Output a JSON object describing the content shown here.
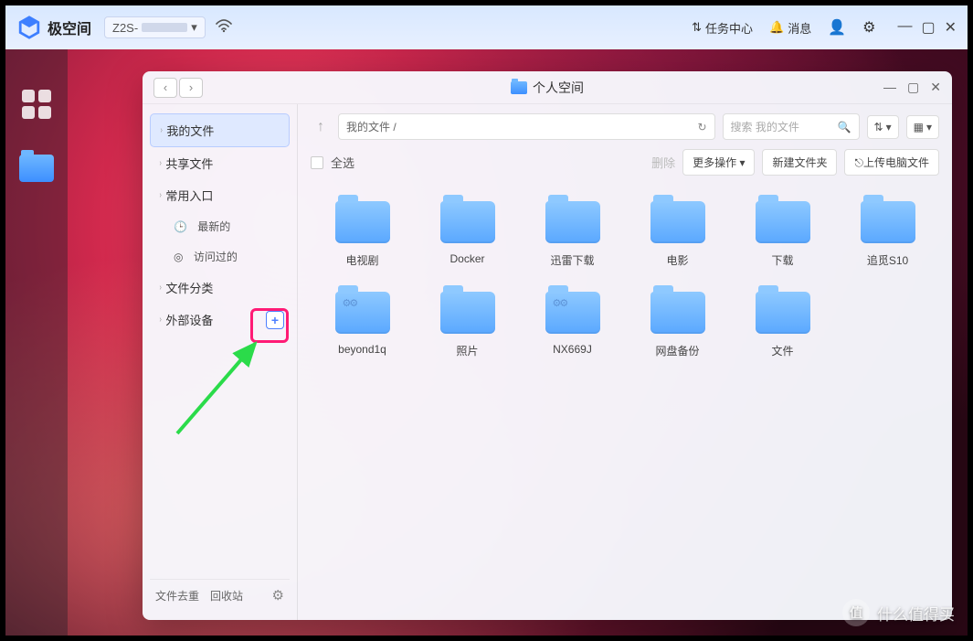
{
  "brand": "极空间",
  "device": "Z2S-",
  "topbar": {
    "tasks": "任务中心",
    "messages": "消息"
  },
  "window": {
    "title": "个人空间",
    "path": "我的文件 /",
    "search_placeholder": "搜索 我的文件"
  },
  "sidebar": {
    "items": [
      "我的文件",
      "共享文件",
      "常用入口",
      "文件分类",
      "外部设备"
    ],
    "sub_recent": "最新的",
    "sub_visited": "访问过的",
    "dedupe": "文件去重",
    "recycle": "回收站"
  },
  "actions": {
    "select_all": "全选",
    "delete": "删除",
    "more": "更多操作",
    "new_folder": "新建文件夹",
    "upload": "上传电脑文件"
  },
  "folders": [
    {
      "name": "电视剧",
      "cogs": false
    },
    {
      "name": "Docker",
      "cogs": false
    },
    {
      "name": "迅雷下载",
      "cogs": false
    },
    {
      "name": "电影",
      "cogs": false
    },
    {
      "name": "下载",
      "cogs": false
    },
    {
      "name": "追觅S10",
      "cogs": false
    },
    {
      "name": "beyond1q",
      "cogs": true
    },
    {
      "name": "照片",
      "cogs": false
    },
    {
      "name": "NX669J",
      "cogs": true
    },
    {
      "name": "网盘备份",
      "cogs": false
    },
    {
      "name": "文件",
      "cogs": false
    }
  ],
  "watermark": "什么值得买"
}
